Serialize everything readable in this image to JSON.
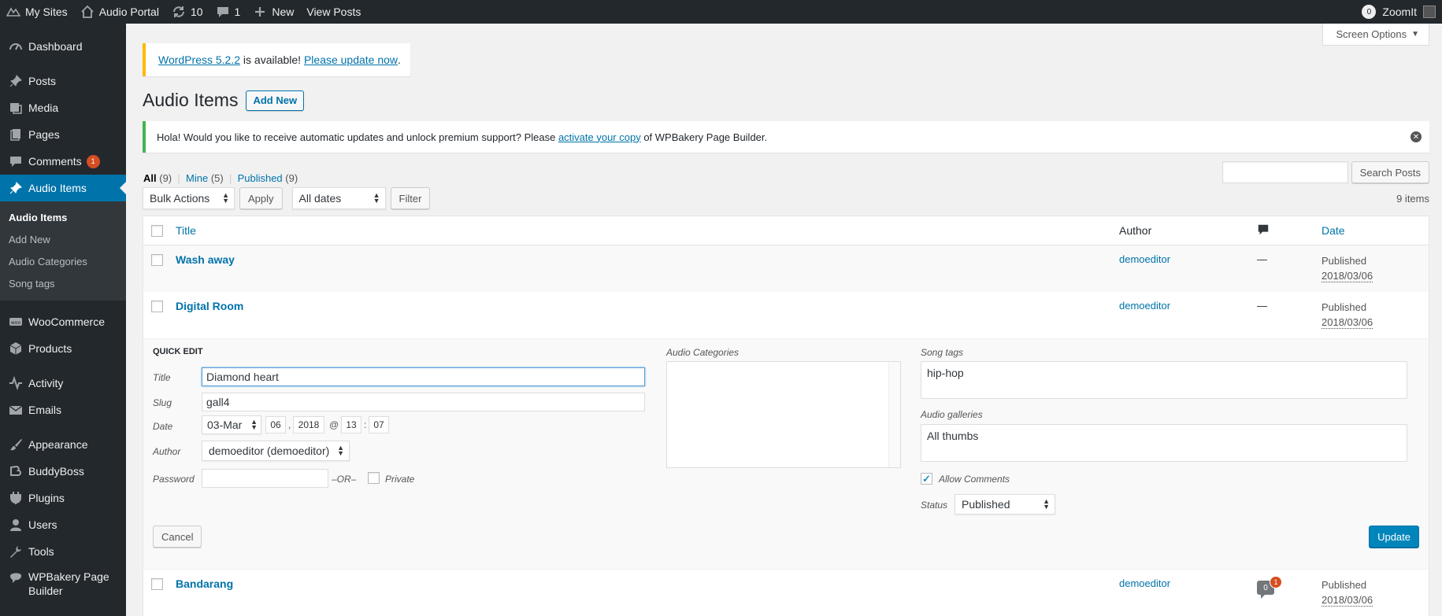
{
  "adminbar": {
    "my_sites": "My Sites",
    "site_name": "Audio Portal",
    "updates_count": "10",
    "comments_count": "1",
    "new_label": "New",
    "view_posts": "View Posts",
    "user_bubble": "0",
    "user_name": "ZoomIt"
  },
  "sidebar": {
    "dashboard": "Dashboard",
    "posts": "Posts",
    "media": "Media",
    "pages": "Pages",
    "comments": "Comments",
    "comments_badge": "1",
    "audio_items": "Audio Items",
    "sub_audio_items": "Audio Items",
    "sub_add_new": "Add New",
    "sub_audio_categories": "Audio Categories",
    "sub_song_tags": "Song tags",
    "woocommerce": "WooCommerce",
    "products": "Products",
    "activity": "Activity",
    "emails": "Emails",
    "appearance": "Appearance",
    "buddyboss": "BuddyBoss",
    "plugins": "Plugins",
    "users": "Users",
    "tools": "Tools",
    "wpbakery": "WPBakery Page Builder"
  },
  "header": {
    "screen_options": "Screen Options",
    "update_link": "WordPress 5.2.2",
    "update_text": " is available! ",
    "update_now": "Please update now",
    "update_end": ".",
    "page_title": "Audio Items",
    "add_new": "Add New",
    "wpb_text_before": "Hola! Would you like to receive automatic updates and unlock premium support? Please ",
    "wpb_link": "activate your copy",
    "wpb_text_after": " of WPBakery Page Builder."
  },
  "filters": {
    "all": "All",
    "all_count": "(9)",
    "mine": "Mine",
    "mine_count": "(5)",
    "published": "Published",
    "published_count": "(9)",
    "search_button": "Search Posts",
    "bulk_actions": "Bulk Actions",
    "apply": "Apply",
    "all_dates": "All dates",
    "filter": "Filter",
    "items_count": "9 items"
  },
  "table": {
    "col_title": "Title",
    "col_author": "Author",
    "col_date": "Date",
    "rows": [
      {
        "title": "Wash away",
        "author": "demoeditor",
        "comments": "—",
        "status": "Published",
        "date": "2018/03/06"
      },
      {
        "title": "Digital Room",
        "author": "demoeditor",
        "comments": "—",
        "status": "Published",
        "date": "2018/03/06"
      },
      {
        "title": "Bandarang",
        "author": "demoeditor",
        "comments": "0",
        "pending": "1",
        "status": "Published",
        "date": "2018/03/06"
      }
    ]
  },
  "quick_edit": {
    "heading": "QUICK EDIT",
    "title_label": "Title",
    "title_value": "Diamond heart",
    "slug_label": "Slug",
    "slug_value": "gall4",
    "date_label": "Date",
    "month": "03-Mar",
    "day": "06",
    "year": "2018",
    "at": "@",
    "hour": "13",
    "colon": ":",
    "minute": "07",
    "comma": ",",
    "author_label": "Author",
    "author_value": "demoeditor (demoeditor)",
    "password_label": "Password",
    "or_label": "–OR–",
    "private_label": "Private",
    "categories_label": "Audio Categories",
    "song_tags_label": "Song tags",
    "song_tags_value": "hip-hop",
    "galleries_label": "Audio galleries",
    "galleries_value": "All thumbs",
    "allow_comments": "Allow Comments",
    "status_label": "Status",
    "status_value": "Published",
    "cancel": "Cancel",
    "update": "Update"
  }
}
